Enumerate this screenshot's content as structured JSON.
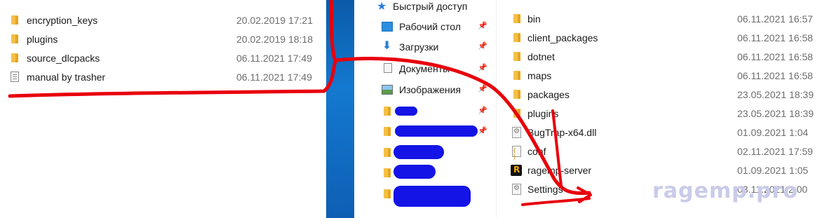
{
  "left_files": [
    {
      "name": "encryption_keys",
      "date": "20.02.2019 17:21",
      "icon": "folder-icon"
    },
    {
      "name": "plugins",
      "date": "20.02.2019 18:18",
      "icon": "folder-icon"
    },
    {
      "name": "source_dlcpacks",
      "date": "06.11.2021 17:49",
      "icon": "folder-icon"
    },
    {
      "name": "manual by trasher",
      "date": "06.11.2021 17:49",
      "icon": "document-icon"
    }
  ],
  "nav_items": [
    {
      "label": "Быстрый доступ",
      "icon": "star-icon"
    },
    {
      "label": "Рабочий стол",
      "icon": "desktop-icon"
    },
    {
      "label": "Загрузки",
      "icon": "downloads-icon"
    },
    {
      "label": "Документы",
      "icon": "documents-icon"
    },
    {
      "label": "Изображения",
      "icon": "pictures-icon"
    }
  ],
  "right_files": [
    {
      "name": "bin",
      "date": "06.11.2021 16:57",
      "icon": "folder-icon"
    },
    {
      "name": "client_packages",
      "date": "06.11.2021 16:58",
      "icon": "folder-icon"
    },
    {
      "name": "dotnet",
      "date": "06.11.2021 16:58",
      "icon": "folder-icon"
    },
    {
      "name": "maps",
      "date": "06.11.2021 16:58",
      "icon": "folder-icon"
    },
    {
      "name": "packages",
      "date": "23.05.2021 18:39",
      "icon": "folder-icon"
    },
    {
      "name": "plugins",
      "date": "23.05.2021 18:39",
      "icon": "folder-icon"
    },
    {
      "name": "BugTrap-x64.dll",
      "date": "01.09.2021 1:04",
      "icon": "dll-file-icon"
    },
    {
      "name": "conf",
      "date": "02.11.2021 17:59",
      "icon": "config-file-icon"
    },
    {
      "name": "ragemp-server",
      "date": "01.09.2021 1:05",
      "icon": "ragemp-app-icon"
    },
    {
      "name": "Settings",
      "date": "03.11.2021 2:00",
      "icon": "settings-file-icon"
    }
  ],
  "watermark": "ragemp.pro",
  "colors": {
    "annotation": "#e8000b",
    "redaction": "#1414e6",
    "folder": "#f5c048"
  }
}
